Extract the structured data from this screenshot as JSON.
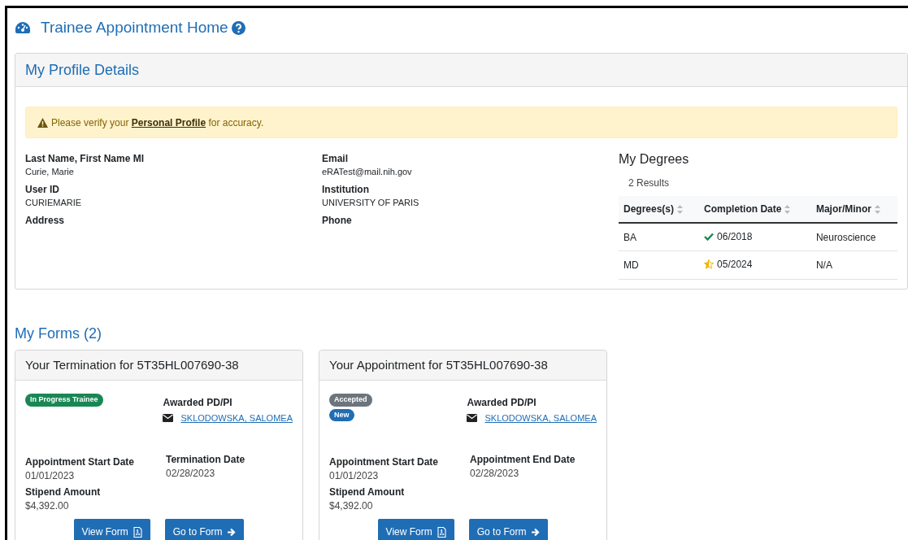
{
  "page": {
    "title": "Trainee Appointment Home"
  },
  "profile": {
    "title": "My Profile Details",
    "alert": "Please verify your **Personal Profile** for accuracy.",
    "fields_left": [
      {
        "label": "Last Name, First Name MI",
        "value": "Curie, Marie"
      },
      {
        "label": "User ID",
        "value": "CURIEMARIE"
      },
      {
        "label": "Address"
      }
    ],
    "fields_right": [
      {
        "label": "Email",
        "value": "eRATest@mail.nih.gov"
      },
      {
        "label": "Institution",
        "value": "UNIVERSITY OF PARIS"
      },
      {
        "label": "Phone"
      }
    ],
    "degrees": {
      "title": "My Degrees",
      "count": "2 Results",
      "columns": [
        "Degrees(s)",
        "Completion Date",
        "Major/Minor"
      ],
      "rows": [
        {
          "degree": "BA",
          "kind": "completed",
          "date": "06/2018",
          "major": "Neuroscience"
        },
        {
          "degree": "MD",
          "kind": "expected",
          "date": "05/2024",
          "major": "N/A"
        }
      ]
    }
  },
  "forms": {
    "title": "My Forms (2)",
    "cards": [
      {
        "title": "Your Termination for 5T35HL007690-38",
        "badges": [
          {
            "label": "In Progress Trainee",
            "color": "#198754"
          }
        ],
        "pi_label": "Awarded PD/PI",
        "pi_name": "SKLODOWSKA, SALOMEA",
        "start_label": "Appointment Start Date",
        "start": "01/01/2023",
        "end_label": "Termination Date",
        "end": "02/28/2023",
        "stipend_label": "Stipend Amount",
        "stipend": "$4,392.00",
        "buttons": [
          "View Form",
          "Go to Form"
        ]
      },
      {
        "title": "Your Appointment for 5T35HL007690-38",
        "badges": [
          {
            "label": "Accepted",
            "color": "#6c757d"
          },
          {
            "label": "New",
            "color": "#1f6db5"
          }
        ],
        "pi_label": "Awarded PD/PI",
        "pi_name": "SKLODOWSKA, SALOMEA",
        "start_label": "Appointment Start Date",
        "start": "01/01/2023",
        "end_label": "Appointment End Date",
        "end": "02/28/2023",
        "stipend_label": "Stipend Amount",
        "stipend": "$4,392.00",
        "buttons": [
          "View Form",
          "Go to Form"
        ]
      }
    ]
  }
}
